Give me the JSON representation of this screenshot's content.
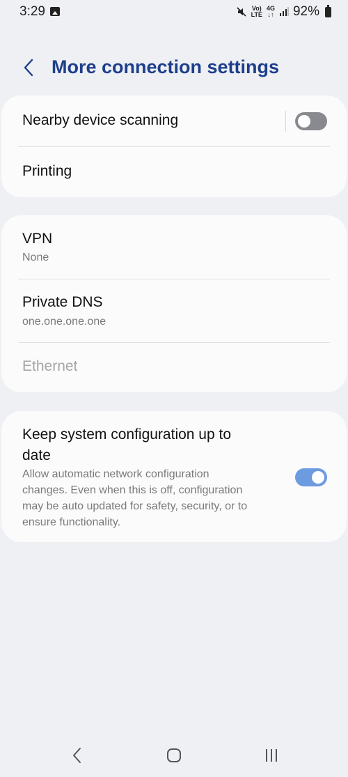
{
  "status_bar": {
    "time": "3:29",
    "net_top": "Vo)",
    "net_bottom": "LTE",
    "net2_top": "4G",
    "net2_bottom": "↓↑",
    "battery": "92%"
  },
  "header": {
    "title": "More connection settings"
  },
  "group1": {
    "nearby_label": "Nearby device scanning",
    "nearby_on": false,
    "printing_label": "Printing"
  },
  "group2": {
    "vpn_label": "VPN",
    "vpn_value": "None",
    "dns_label": "Private DNS",
    "dns_value": "one.one.one.one",
    "ethernet_label": "Ethernet"
  },
  "group3": {
    "title_line1": "Keep system configuration up to",
    "title_line2": "date",
    "desc_line1": "Allow automatic network configuration",
    "desc_line2": "changes. Even when this is off, configuration",
    "desc_line3": "may be auto updated for safety, security, or to",
    "desc_line4": "ensure functionality.",
    "enabled": true
  },
  "colors": {
    "accent": "#1d3f8b",
    "toggle_on": "#6d9be0",
    "toggle_off": "#888a8f",
    "background": "#eff0f4",
    "card": "#fbfbfb"
  },
  "icons": {
    "back": "chevron-left-icon",
    "mute": "mute-icon",
    "signal": "signal-icon",
    "battery": "battery-icon",
    "nav_back": "nav-back-icon",
    "nav_home": "nav-home-icon",
    "nav_recents": "nav-recents-icon"
  }
}
